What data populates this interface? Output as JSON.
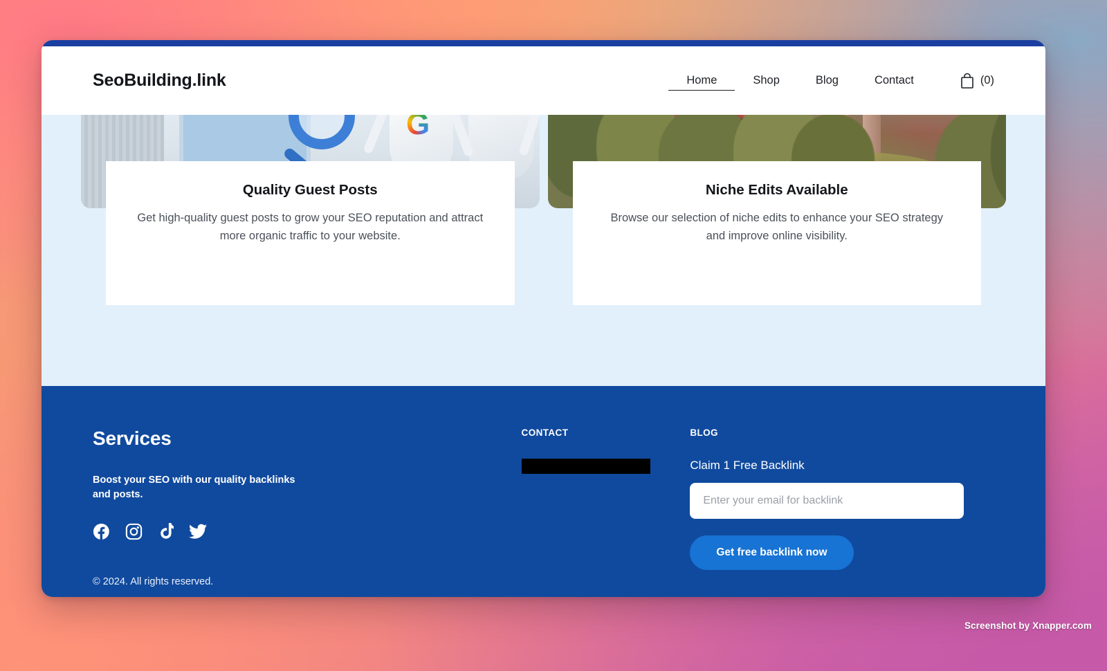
{
  "header": {
    "brand": "SeoBuilding.link",
    "nav": [
      {
        "label": "Home",
        "active": true
      },
      {
        "label": "Shop",
        "active": false
      },
      {
        "label": "Blog",
        "active": false
      },
      {
        "label": "Contact",
        "active": false
      }
    ],
    "cart": {
      "icon": "shopping-bag-icon",
      "count": "(0)"
    }
  },
  "main": {
    "cards": [
      {
        "image": "seo-3d-illustration-magnifier-google",
        "title": "Quality Guest Posts",
        "description": "Get high-quality guest posts to grow your SEO reputation and attract more organic traffic to your website."
      },
      {
        "image": "red-truss-bridge-over-trees-photo",
        "title": "Niche Edits Available",
        "description": "Browse our selection of niche edits to enhance your SEO strategy and improve online visibility."
      }
    ]
  },
  "footer": {
    "services": {
      "title": "Services",
      "description": "Boost your SEO with our quality backlinks and posts.",
      "socials": [
        {
          "name": "facebook-icon"
        },
        {
          "name": "instagram-icon"
        },
        {
          "name": "tiktok-icon"
        },
        {
          "name": "twitter-icon"
        }
      ]
    },
    "contact": {
      "heading": "CONTACT",
      "redacted_value": ""
    },
    "blog": {
      "heading": "BLOG",
      "offer_label": "Claim 1 Free Backlink",
      "email_placeholder": "Enter your email for backlink",
      "email_value": "",
      "cta_label": "Get free backlink now"
    },
    "copyright": "© 2024. All rights reserved."
  },
  "watermark": "Screenshot by Xnapper.com",
  "colors": {
    "footer_blue": "#104a9e",
    "topbar_blue": "#1a3fa0",
    "cta_blue": "#1773d4",
    "content_bg": "#e2f0fb"
  }
}
